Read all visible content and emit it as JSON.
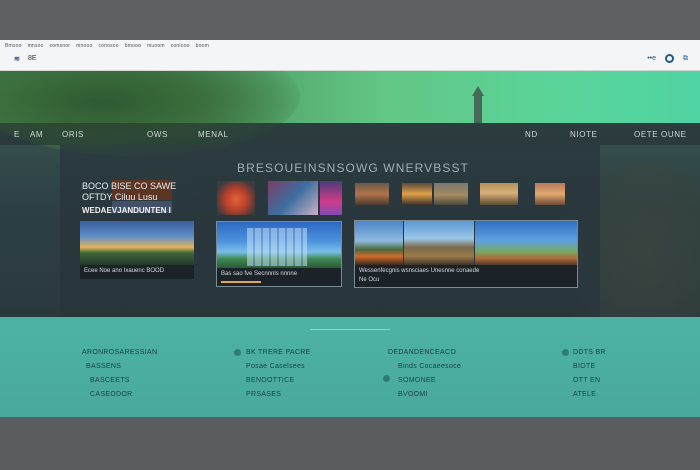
{
  "browser": {
    "bookmarks": [
      "Bmsoo",
      "mnsoo",
      "comsnor",
      "mnooo",
      "conosoo",
      "bmooo",
      "muoom",
      "conlooo",
      "boom"
    ],
    "addr_left": "≋",
    "logo_text": "8E",
    "addr_right_text": "••e"
  },
  "nav": {
    "left_icon": "E",
    "left_1": "AM",
    "left_2": "ORIS",
    "left_3": "OWS",
    "left_4": "MENAL",
    "right_1": "ND",
    "right_2": "NIOTE",
    "right_3": "OETE OUNE"
  },
  "main": {
    "headline": "BRESOUEINSNSOWG WNERVBSST"
  },
  "promo": {
    "line1": "BOCO  BISE CO SAWE",
    "line2": "OFTDY  Ciluu  Lusu",
    "line3": "WEDAEVJANDUNTEN I",
    "caption": "Ecee Noe ano Ixauenc BOOD"
  },
  "card_mid": {
    "caption": "Bas sao fve Secnnnls nnnne"
  },
  "card_right": {
    "caption": "Wessenfecgnis wsnsciaes Unesnne conaede",
    "sub": "Ne Ocu"
  },
  "footer": {
    "col1": {
      "title": "ARONROSARESSIAN",
      "items": [
        "BASSENS",
        "BASCEETS",
        "CASEODOR"
      ]
    },
    "col2": {
      "title": "BK TRERE PACRE",
      "items": [
        "Posae Caselsees",
        "BENOOTTICE",
        "PRSASES"
      ]
    },
    "col3": {
      "title": "DEDANDENCEACO",
      "items": [
        "Binds Cocaeesoce",
        "SOMONEE",
        "BVOOMI"
      ]
    },
    "col4": {
      "title": "DDTS BR",
      "items": [
        "BIOTE",
        "OTT EN",
        "ATELE"
      ]
    }
  }
}
